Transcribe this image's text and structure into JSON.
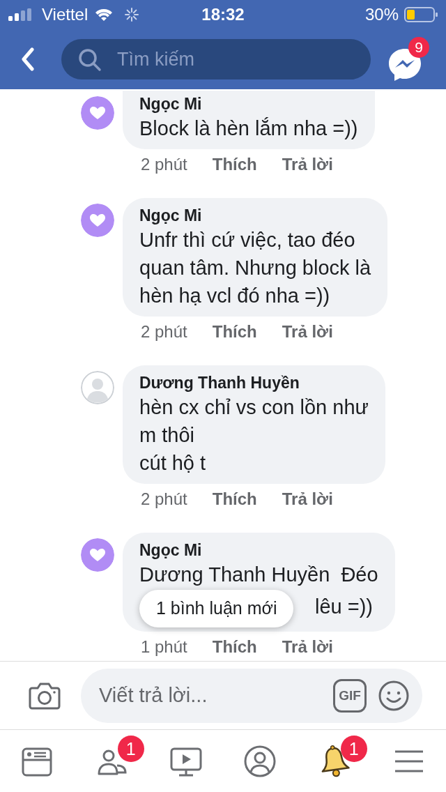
{
  "status_bar": {
    "carrier": "Viettel",
    "time": "18:32",
    "battery": "30%"
  },
  "header": {
    "search": {
      "placeholder": "Tìm kiếm"
    },
    "messenger_badge": "9"
  },
  "comments": [
    {
      "author": "Ngọc Mi",
      "avatar": {
        "kind": "heart"
      },
      "message": "Block là hèn lắm nha =))",
      "time": "2 phút",
      "like": "Thích",
      "reply": "Trả lời"
    },
    {
      "author": "Ngọc Mi",
      "avatar": {
        "kind": "heart"
      },
      "message": "Unfr thì cứ việc, tao đéo\nquan tâm. Nhưng block là\nhèn hạ vcl đó nha =))",
      "time": "2 phút",
      "like": "Thích",
      "reply": "Trả lời"
    },
    {
      "author": "Dương Thanh Huyền",
      "avatar": {
        "kind": "default"
      },
      "message": "hèn cx chỉ vs con lồn như\nm thôi\ncút hộ t",
      "time": "2 phút",
      "like": "Thích",
      "reply": "Trả lời"
    },
    {
      "author": "Ngọc Mi",
      "avatar": {
        "kind": "heart"
      },
      "message": "Dương Thanh Huyền  Đéo",
      "message_tail": "lêu =))",
      "time": "1 phút",
      "like": "Thích",
      "reply": "Trả lời"
    }
  ],
  "new_comments_pill": "1 bình luận mới",
  "composer": {
    "placeholder": "Viết trả lời...",
    "gif": "GIF"
  },
  "tab_bar": [
    {
      "kind": "feed",
      "selected": false
    },
    {
      "kind": "friends",
      "selected": false,
      "badge": "1"
    },
    {
      "kind": "watch",
      "selected": false
    },
    {
      "kind": "profile",
      "selected": false
    },
    {
      "kind": "notifications",
      "selected": true,
      "badge": "1"
    },
    {
      "kind": "menu",
      "selected": false
    }
  ]
}
